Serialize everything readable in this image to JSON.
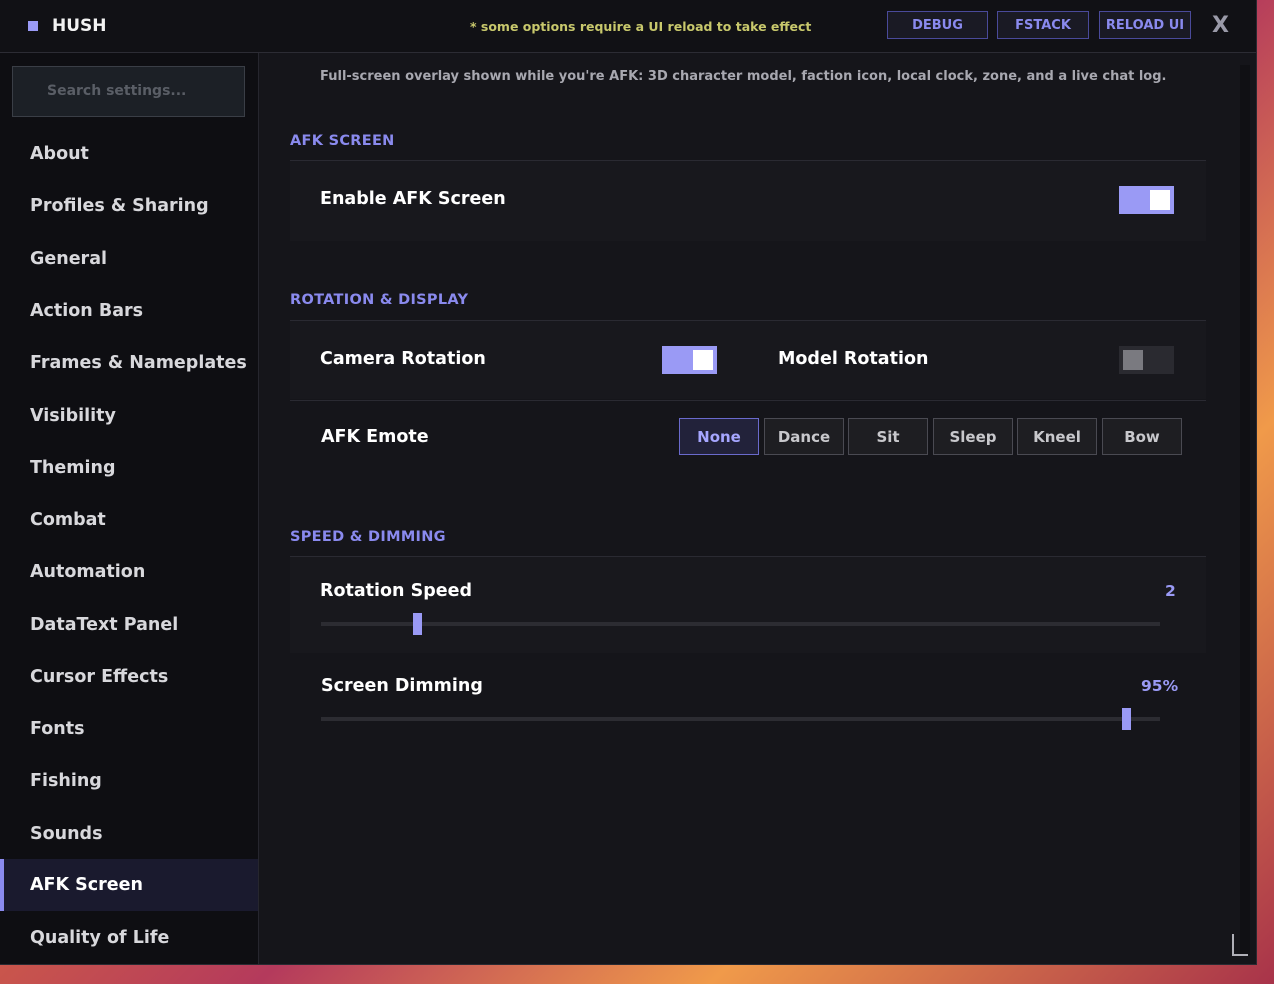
{
  "app": {
    "title": "HUSH",
    "reload_note": "* some options require a UI reload to take effect",
    "buttons": {
      "debug": "DEBUG",
      "fstack": "FSTACK",
      "reload": "RELOAD UI"
    },
    "close": "X"
  },
  "sidebar": {
    "search_placeholder": "Search settings...",
    "items": [
      {
        "label": "About"
      },
      {
        "label": "Profiles & Sharing"
      },
      {
        "label": "General"
      },
      {
        "label": "Action Bars"
      },
      {
        "label": "Frames & Nameplates"
      },
      {
        "label": "Visibility"
      },
      {
        "label": "Theming"
      },
      {
        "label": "Combat"
      },
      {
        "label": "Automation"
      },
      {
        "label": "DataText Panel"
      },
      {
        "label": "Cursor Effects"
      },
      {
        "label": "Fonts"
      },
      {
        "label": "Fishing"
      },
      {
        "label": "Sounds"
      },
      {
        "label": "AFK Screen",
        "active": true
      },
      {
        "label": "Quality of Life"
      }
    ]
  },
  "main": {
    "description": "Full-screen overlay shown while you're AFK: 3D character model, faction icon, local clock, zone, and a live chat log.",
    "sections": {
      "afk_screen": {
        "title": "AFK SCREEN",
        "enable_label": "Enable AFK Screen",
        "enable_value": true
      },
      "rotation_display": {
        "title": "ROTATION & DISPLAY",
        "camera_rotation_label": "Camera Rotation",
        "camera_rotation_value": true,
        "model_rotation_label": "Model Rotation",
        "model_rotation_value": false,
        "emote_label": "AFK Emote",
        "emote_options": [
          "None",
          "Dance",
          "Sit",
          "Sleep",
          "Kneel",
          "Bow"
        ],
        "emote_selected": "None"
      },
      "speed_dimming": {
        "title": "SPEED & DIMMING",
        "rotation_speed_label": "Rotation Speed",
        "rotation_speed_value": "2",
        "rotation_speed_fraction": 0.115,
        "screen_dimming_label": "Screen Dimming",
        "screen_dimming_value": "95%",
        "screen_dimming_fraction": 0.96
      }
    }
  },
  "colors": {
    "accent": "#9a9af5",
    "warning_text": "#c8c86c",
    "background": "#15151a"
  }
}
